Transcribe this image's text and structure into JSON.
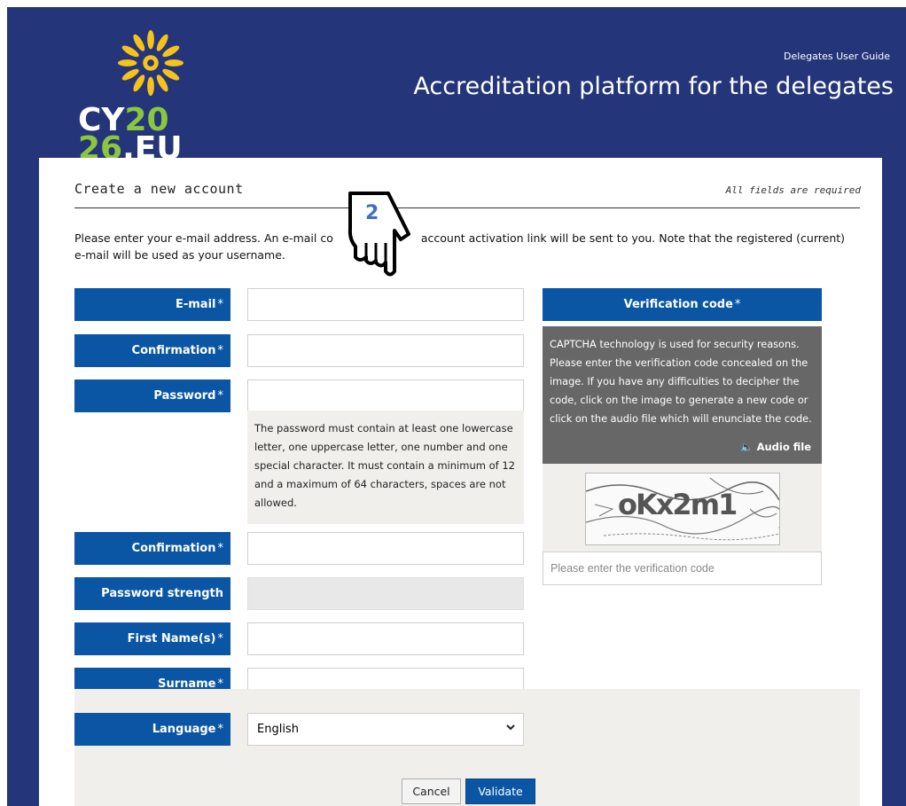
{
  "header": {
    "logo": {
      "line1_white": "CY",
      "line1_green": "20",
      "line2_green": "26",
      "line2_white": ".EU"
    },
    "guide_link": "Delegates User Guide",
    "site_title": "Accreditation platform for the delegates"
  },
  "form": {
    "title": "Create a new account",
    "required_note": "All fields are required",
    "intro_part1": "Please enter your e-mail address. An e-mail co",
    "intro_part2": " account activation link will be sent to you. Note that the registered (current)",
    "intro_line2": "e-mail will be used as your username.",
    "required_mark": "*",
    "fields": {
      "email": {
        "label": "E-mail",
        "value": ""
      },
      "email_confirm": {
        "label": "Confirmation",
        "value": ""
      },
      "password": {
        "label": "Password",
        "value": ""
      },
      "password_help": "The password must contain at least one lowercase letter, one uppercase letter, one number and one special character. It must contain a minimum of 12 and a maximum of 64 characters, spaces are not allowed.",
      "password_confirm": {
        "label": "Confirmation",
        "value": ""
      },
      "password_strength": {
        "label": "Password strength",
        "value": ""
      },
      "first_name": {
        "label": "First Name(s)",
        "value": ""
      },
      "surname": {
        "label": "Surname",
        "value": ""
      },
      "language": {
        "label": "Language",
        "value": "English"
      }
    },
    "verification": {
      "title": "Verification code",
      "help": "CAPTCHA technology is used for security reasons. Please enter the verification code concealed on the image. If you have any difficulties to decipher the code, click on the image to generate a new code or click on the audio file which will enunciate the code.",
      "audio_label": "Audio file",
      "captcha_text": "oKx2m1",
      "input_placeholder": "Please enter the verification code"
    },
    "buttons": {
      "cancel": "Cancel",
      "validate": "Validate"
    }
  },
  "annotation": {
    "step_number": "2"
  },
  "colors": {
    "header_bg": "#24357a",
    "label_bg": "#0b56a4",
    "logo_green": "#8cc63f",
    "sun_yellow": "#f7c21a"
  }
}
